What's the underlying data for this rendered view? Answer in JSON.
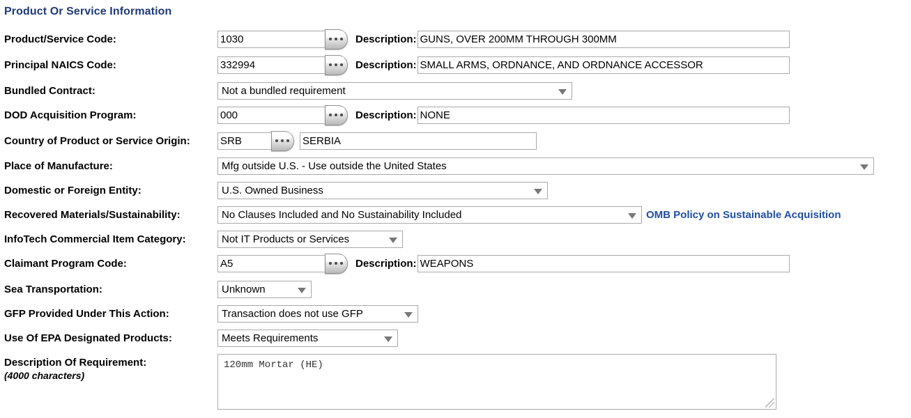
{
  "section": {
    "title": "Product Or Service Information",
    "title_color": "#1f3a7a"
  },
  "link_color": "#1f4fa3",
  "fields": {
    "product_service_code": {
      "label": "Product/Service Code:",
      "value": "1030",
      "lookup_icon": "ellipsis-lookup-icon",
      "description_label": "Description:",
      "description_value": "GUNS, OVER 200MM THROUGH 300MM"
    },
    "principal_naics_code": {
      "label": "Principal NAICS Code:",
      "value": "332994",
      "lookup_icon": "ellipsis-lookup-icon",
      "description_label": "Description:",
      "description_value": "SMALL ARMS, ORDNANCE, AND ORDNANCE ACCESSOR"
    },
    "bundled_contract": {
      "label": "Bundled Contract:",
      "value": "Not a bundled requirement"
    },
    "dod_acquisition_program": {
      "label": "DOD Acquisition Program:",
      "value": "000",
      "lookup_icon": "ellipsis-lookup-icon",
      "description_label": "Description:",
      "description_value": "NONE"
    },
    "country_of_origin": {
      "label": "Country of Product or Service Origin:",
      "code": "SRB",
      "lookup_icon": "ellipsis-lookup-icon",
      "name": "SERBIA"
    },
    "place_of_manufacture": {
      "label": "Place of Manufacture:",
      "value": "Mfg outside U.S. - Use outside the United States"
    },
    "domestic_or_foreign_entity": {
      "label": "Domestic or Foreign Entity:",
      "value": "U.S. Owned Business"
    },
    "recovered_materials": {
      "label": "Recovered Materials/Sustainability:",
      "value": "No Clauses Included and No Sustainability Included",
      "link_text": "OMB Policy on Sustainable Acquisition"
    },
    "infotech_commercial_item_category": {
      "label": "InfoTech Commercial Item Category:",
      "value": "Not IT Products or Services"
    },
    "claimant_program_code": {
      "label": "Claimant Program Code:",
      "value": "A5",
      "lookup_icon": "ellipsis-lookup-icon",
      "description_label": "Description:",
      "description_value": "WEAPONS"
    },
    "sea_transportation": {
      "label": "Sea Transportation:",
      "value": "Unknown"
    },
    "gfp_provided": {
      "label": "GFP Provided Under This Action:",
      "value": "Transaction does not use GFP"
    },
    "epa_designated_products": {
      "label": "Use Of EPA Designated Products:",
      "value": "Meets Requirements"
    },
    "description_of_requirement": {
      "label": "Description Of Requirement:",
      "sublabel": "(4000 characters)",
      "value": "120mm Mortar (HE)"
    }
  }
}
